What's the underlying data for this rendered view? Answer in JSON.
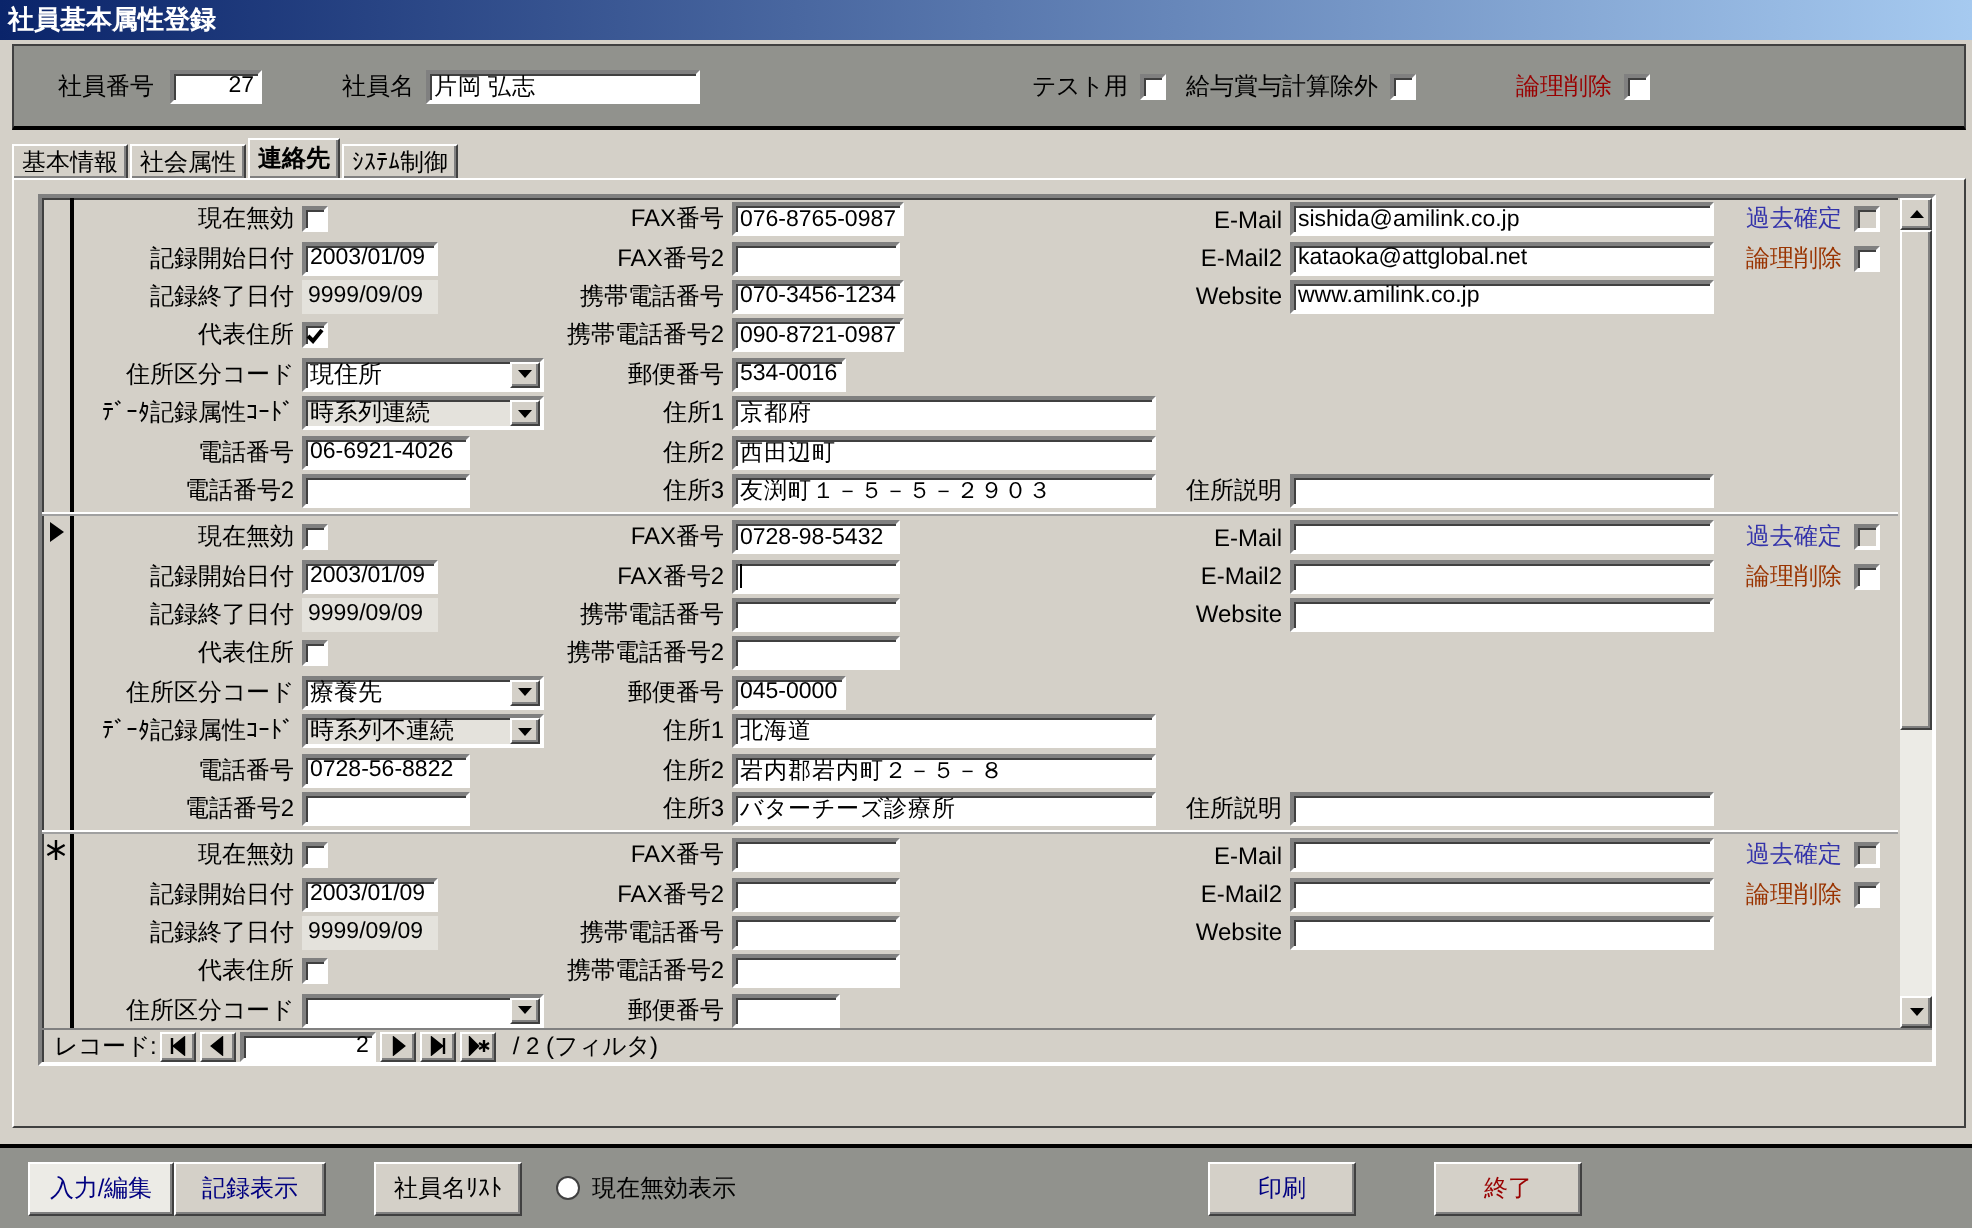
{
  "window": {
    "title": "社員基本属性登録"
  },
  "header": {
    "employee_no": {
      "label": "社員番号",
      "value": "27"
    },
    "employee_name": {
      "label": "社員名",
      "value": "片岡 弘志"
    },
    "checks": [
      {
        "label": "テスト用",
        "checked": false,
        "color": "#000000"
      },
      {
        "label": "給与賞与計算除外",
        "checked": false,
        "color": "#000000"
      },
      {
        "label": "論理削除",
        "checked": false,
        "color": "#990000"
      }
    ]
  },
  "tabs": [
    {
      "label": "基本情報",
      "selected": false
    },
    {
      "label": "社会属性",
      "selected": false
    },
    {
      "label": "連絡先",
      "selected": true
    },
    {
      "label": "ｼｽﾃﾑ制御",
      "selected": false
    }
  ],
  "records": [
    {
      "current": false,
      "new": false,
      "left": [
        {
          "label": "現在無効",
          "kind": "checkbox",
          "checked": false
        },
        {
          "label": "記録開始日付",
          "kind": "date",
          "value": "2003/01/09"
        },
        {
          "label": "記録終了日付",
          "kind": "fixed-date",
          "value": "9999/09/09"
        },
        {
          "label": "代表住所",
          "kind": "checkbox",
          "checked": true
        },
        {
          "label": "住所区分コード",
          "kind": "combo",
          "value": "現住所"
        },
        {
          "label": "ﾃﾞｰﾀ記録属性ｺｰﾄﾞ",
          "kind": "fixed-combo",
          "value": "時系列連続"
        },
        {
          "label": "電話番号",
          "kind": "phone",
          "value": "06-6921-4026"
        },
        {
          "label": "電話番号2",
          "kind": "phone"
        }
      ],
      "middle": [
        {
          "label": "FAX番号",
          "kind": "phone",
          "value": "076-8765-0987"
        },
        {
          "label": "FAX番号2",
          "kind": "phone"
        },
        {
          "label": "携帯電話番号",
          "kind": "phone",
          "value": "070-3456-1234"
        },
        {
          "label": "携帯電話番号2",
          "kind": "phone",
          "value": "090-8721-0987"
        },
        {
          "label": "郵便番号",
          "kind": "postal",
          "value": "534-0016"
        },
        {
          "label": "住所1",
          "kind": "wide",
          "value": "京都府"
        },
        {
          "label": "住所2",
          "kind": "wide",
          "value": "西田辺町"
        },
        {
          "label": "住所3",
          "kind": "wide",
          "value": "友渕町１－５－５－２９０３"
        }
      ],
      "right": [
        {
          "label": "E-Mail",
          "kind": "wide",
          "value": "sishida@amilink.co.jp"
        },
        {
          "label": "E-Mail2",
          "kind": "wide",
          "value": "kataoka@attglobal.net"
        },
        {
          "label": "Website",
          "kind": "wide",
          "value": "www.amilink.co.jp"
        }
      ],
      "note": {
        "label": "住所説明"
      },
      "flags": [
        {
          "label": "過去確定",
          "checked": false,
          "disabled": true,
          "color": "#3333aa"
        },
        {
          "label": "論理削除",
          "checked": false,
          "disabled": false,
          "color": "#993300"
        }
      ]
    },
    {
      "current": true,
      "new": false,
      "left": [
        {
          "label": "現在無効",
          "kind": "checkbox",
          "checked": false
        },
        {
          "label": "記録開始日付",
          "kind": "date",
          "value": "2003/01/09"
        },
        {
          "label": "記録終了日付",
          "kind": "fixed-date",
          "value": "9999/09/09"
        },
        {
          "label": "代表住所",
          "kind": "checkbox",
          "checked": false
        },
        {
          "label": "住所区分コード",
          "kind": "combo",
          "value": "療養先"
        },
        {
          "label": "ﾃﾞｰﾀ記録属性ｺｰﾄﾞ",
          "kind": "fixed-combo",
          "value": "時系列不連続"
        },
        {
          "label": "電話番号",
          "kind": "phone",
          "value": "0728-56-8822"
        },
        {
          "label": "電話番号2",
          "kind": "phone"
        }
      ],
      "middle": [
        {
          "label": "FAX番号",
          "kind": "phone",
          "value": "0728-98-5432"
        },
        {
          "label": "FAX番号2",
          "kind": "phone",
          "focused": true
        },
        {
          "label": "携帯電話番号",
          "kind": "phone"
        },
        {
          "label": "携帯電話番号2",
          "kind": "phone"
        },
        {
          "label": "郵便番号",
          "kind": "postal",
          "value": "045-0000"
        },
        {
          "label": "住所1",
          "kind": "wide",
          "value": "北海道"
        },
        {
          "label": "住所2",
          "kind": "wide",
          "value": "岩内郡岩内町２－５－８"
        },
        {
          "label": "住所3",
          "kind": "wide",
          "value": "バターチーズ診療所"
        }
      ],
      "right": [
        {
          "label": "E-Mail",
          "kind": "wide"
        },
        {
          "label": "E-Mail2",
          "kind": "wide"
        },
        {
          "label": "Website",
          "kind": "wide"
        }
      ],
      "note": {
        "label": "住所説明"
      },
      "flags": [
        {
          "label": "過去確定",
          "checked": false,
          "disabled": true,
          "color": "#3333aa"
        },
        {
          "label": "論理削除",
          "checked": false,
          "disabled": false,
          "color": "#993300"
        }
      ]
    },
    {
      "current": false,
      "new": true,
      "left": [
        {
          "label": "現在無効",
          "kind": "checkbox",
          "checked": false
        },
        {
          "label": "記録開始日付",
          "kind": "date",
          "value": "2003/01/09"
        },
        {
          "label": "記録終了日付",
          "kind": "fixed-date",
          "value": "9999/09/09"
        },
        {
          "label": "代表住所",
          "kind": "checkbox",
          "checked": false
        },
        {
          "label": "住所区分コード",
          "kind": "combo"
        }
      ],
      "middle": [
        {
          "label": "FAX番号",
          "kind": "phone"
        },
        {
          "label": "FAX番号2",
          "kind": "phone"
        },
        {
          "label": "携帯電話番号",
          "kind": "phone"
        },
        {
          "label": "携帯電話番号2",
          "kind": "phone"
        },
        {
          "label": "郵便番号",
          "kind": "postal"
        }
      ],
      "right": [
        {
          "label": "E-Mail",
          "kind": "wide"
        },
        {
          "label": "E-Mail2",
          "kind": "wide"
        },
        {
          "label": "Website",
          "kind": "wide"
        }
      ],
      "flags": [
        {
          "label": "過去確定",
          "checked": false,
          "disabled": true,
          "color": "#3333aa"
        },
        {
          "label": "論理削除",
          "checked": false,
          "disabled": false,
          "color": "#993300"
        }
      ]
    }
  ],
  "navigator": {
    "label": "レコード:",
    "current": "2",
    "total": "/ 2 (フィルタ)"
  },
  "footer": {
    "toggles": [
      {
        "label": "入力/編集",
        "selected": true
      },
      {
        "label": "記録表示",
        "selected": false
      }
    ],
    "list_button": {
      "label": "社員名ﾘｽﾄ"
    },
    "radio": {
      "label": "現在無効表示",
      "selected": false
    },
    "actions": [
      {
        "label": "印刷",
        "color": "#000080"
      },
      {
        "label": "終了",
        "color": "#990000"
      }
    ]
  }
}
